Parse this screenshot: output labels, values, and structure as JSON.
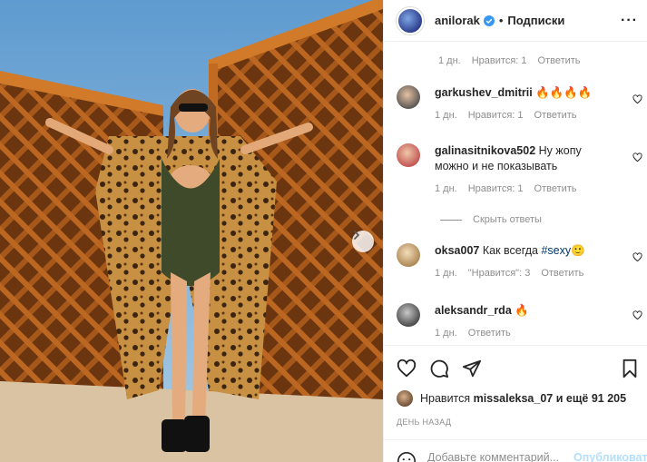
{
  "post": {
    "photo_alt": "",
    "photo_colors": {
      "sky": "#7db0d8",
      "wood": "#b5651d",
      "swimsuit": "#3f4a2a",
      "leopard": "#c48a3e"
    }
  },
  "header": {
    "username": "anilorak",
    "separator": "•",
    "follow_label": "Подписки",
    "more_label": "···"
  },
  "comments": [
    {
      "id": "c0",
      "user": "",
      "text": "",
      "meta": {
        "age": "1 дн.",
        "likes": "Нравится: 1",
        "reply": "Ответить"
      }
    },
    {
      "id": "c1",
      "user": "garkushev_dmitrii",
      "text": "🔥🔥🔥🔥",
      "meta": {
        "age": "1 дн.",
        "likes": "Нравится: 1",
        "reply": "Ответить"
      }
    },
    {
      "id": "c2",
      "user": "galinasitnikova502",
      "text": "Ну жопу можно и не показывать",
      "meta": {
        "age": "1 дн.",
        "likes": "Нравится: 1",
        "reply": "Ответить"
      }
    },
    {
      "id": "c3",
      "user": "oksa007",
      "text": "Как всегда ",
      "tag": "#sexy",
      "emoji": "🙂",
      "meta": {
        "age": "1 дн.",
        "likes": "\"Нравится\": 3",
        "reply": "Ответить"
      }
    },
    {
      "id": "c4",
      "user": "aleksandr_rda",
      "text": "🔥",
      "meta": {
        "age": "1 дн.",
        "reply": "Ответить"
      }
    }
  ],
  "hide_replies_label": "Скрыть ответы",
  "likes": {
    "prefix": "Нравится",
    "user": "missaleksa_07",
    "suffix": "и ещё 91 205"
  },
  "date_label": "ДЕНЬ НАЗАД",
  "add_comment": {
    "placeholder": "Добавьте комментарий...",
    "publish_label": "Опубликовать"
  }
}
